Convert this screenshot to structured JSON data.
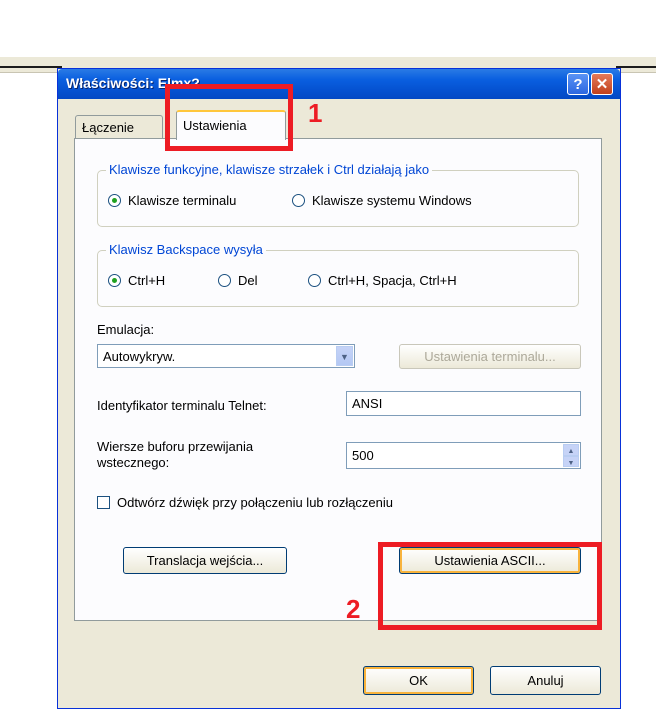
{
  "dialog": {
    "title": "Właściwości: Elmx?",
    "help_symbol": "?",
    "close_symbol": "✕"
  },
  "tabs": [
    {
      "label": "Łączenie"
    },
    {
      "label": "Ustawienia"
    }
  ],
  "function_keys_group": {
    "legend": "Klawisze funkcyjne, klawisze strzałek i Ctrl działają jako",
    "options": [
      {
        "label": "Klawisze terminalu",
        "selected": true
      },
      {
        "label": "Klawisze systemu Windows",
        "selected": false
      }
    ]
  },
  "backspace_group": {
    "legend": "Klawisz Backspace wysyła",
    "options": [
      {
        "label": "Ctrl+H",
        "selected": true
      },
      {
        "label": "Del",
        "selected": false
      },
      {
        "label": "Ctrl+H, Spacja, Ctrl+H",
        "selected": false
      }
    ]
  },
  "emulation": {
    "label": "Emulacja:",
    "value": "Autowykryw.",
    "terminal_settings_button": "Ustawienia terminalu..."
  },
  "telnet_id": {
    "label": "Identyfikator terminalu Telnet:",
    "value": "ANSI"
  },
  "scrollback": {
    "label_line1": "Wiersze buforu przewijania",
    "label_line2": "wstecznego:",
    "value": "500"
  },
  "sound_checkbox": {
    "label": "Odtwórz dźwięk przy połączeniu lub rozłączeniu",
    "checked": false
  },
  "buttons": {
    "input_translation": "Translacja wejścia...",
    "ascii_settings": "Ustawienia ASCII...",
    "ok": "OK",
    "cancel": "Anuluj"
  },
  "annotations": {
    "marker_1": "1",
    "marker_2": "2",
    "color": "#ed1c24"
  }
}
